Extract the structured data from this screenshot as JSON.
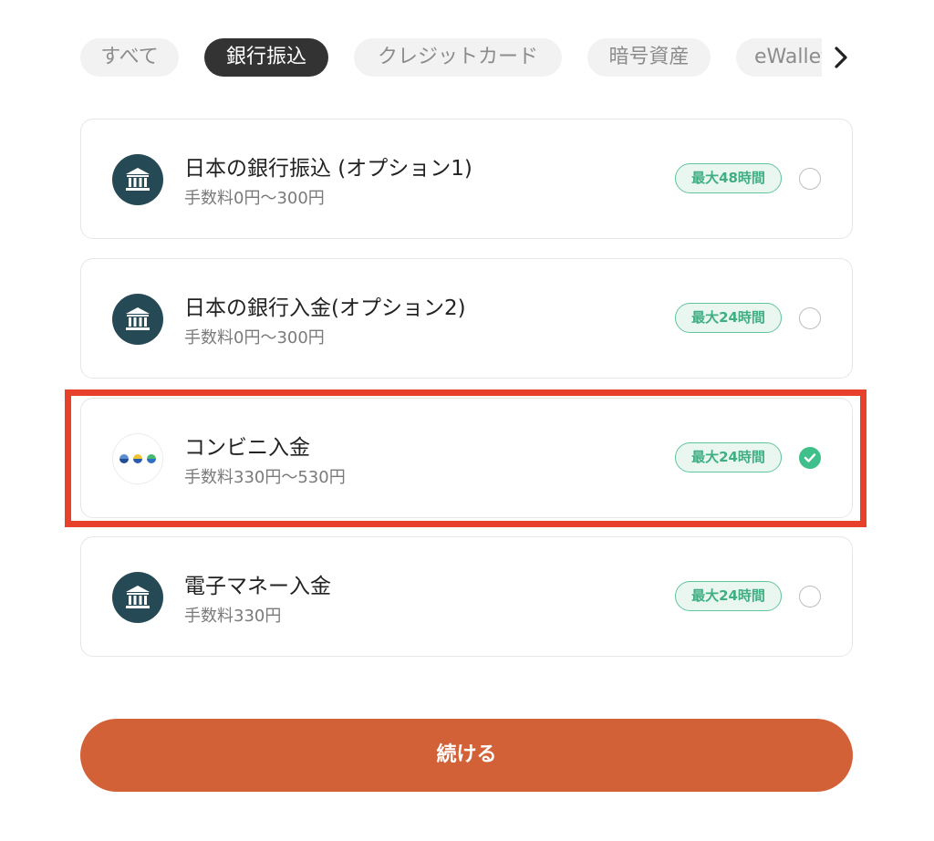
{
  "tabs": [
    {
      "label": "すべて",
      "active": false
    },
    {
      "label": "銀行振込",
      "active": true
    },
    {
      "label": "クレジットカード",
      "active": false
    },
    {
      "label": "暗号資産",
      "active": false
    },
    {
      "label": "eWallet",
      "active": false
    }
  ],
  "methods": [
    {
      "title": "日本の銀行振込 (オプション1)",
      "fee": "手数料0円〜300円",
      "badge": "最大48時間",
      "icon": "bank-icon",
      "selected": false
    },
    {
      "title": "日本の銀行入金(オプション2)",
      "fee": "手数料0円〜300円",
      "badge": "最大24時間",
      "icon": "bank-icon",
      "selected": false
    },
    {
      "title": "コンビニ入金",
      "fee": "手数料330円〜530円",
      "badge": "最大24時間",
      "icon": "convenience-store-icon",
      "selected": true
    },
    {
      "title": "電子マネー入金",
      "fee": "手数料330円",
      "badge": "最大24時間",
      "icon": "bank-icon",
      "selected": false
    }
  ],
  "continue_label": "続ける",
  "colors": {
    "accent": "#d36137",
    "badge_green": "#3fae83",
    "icon_dark": "#264a55",
    "highlight": "#e8412b"
  }
}
